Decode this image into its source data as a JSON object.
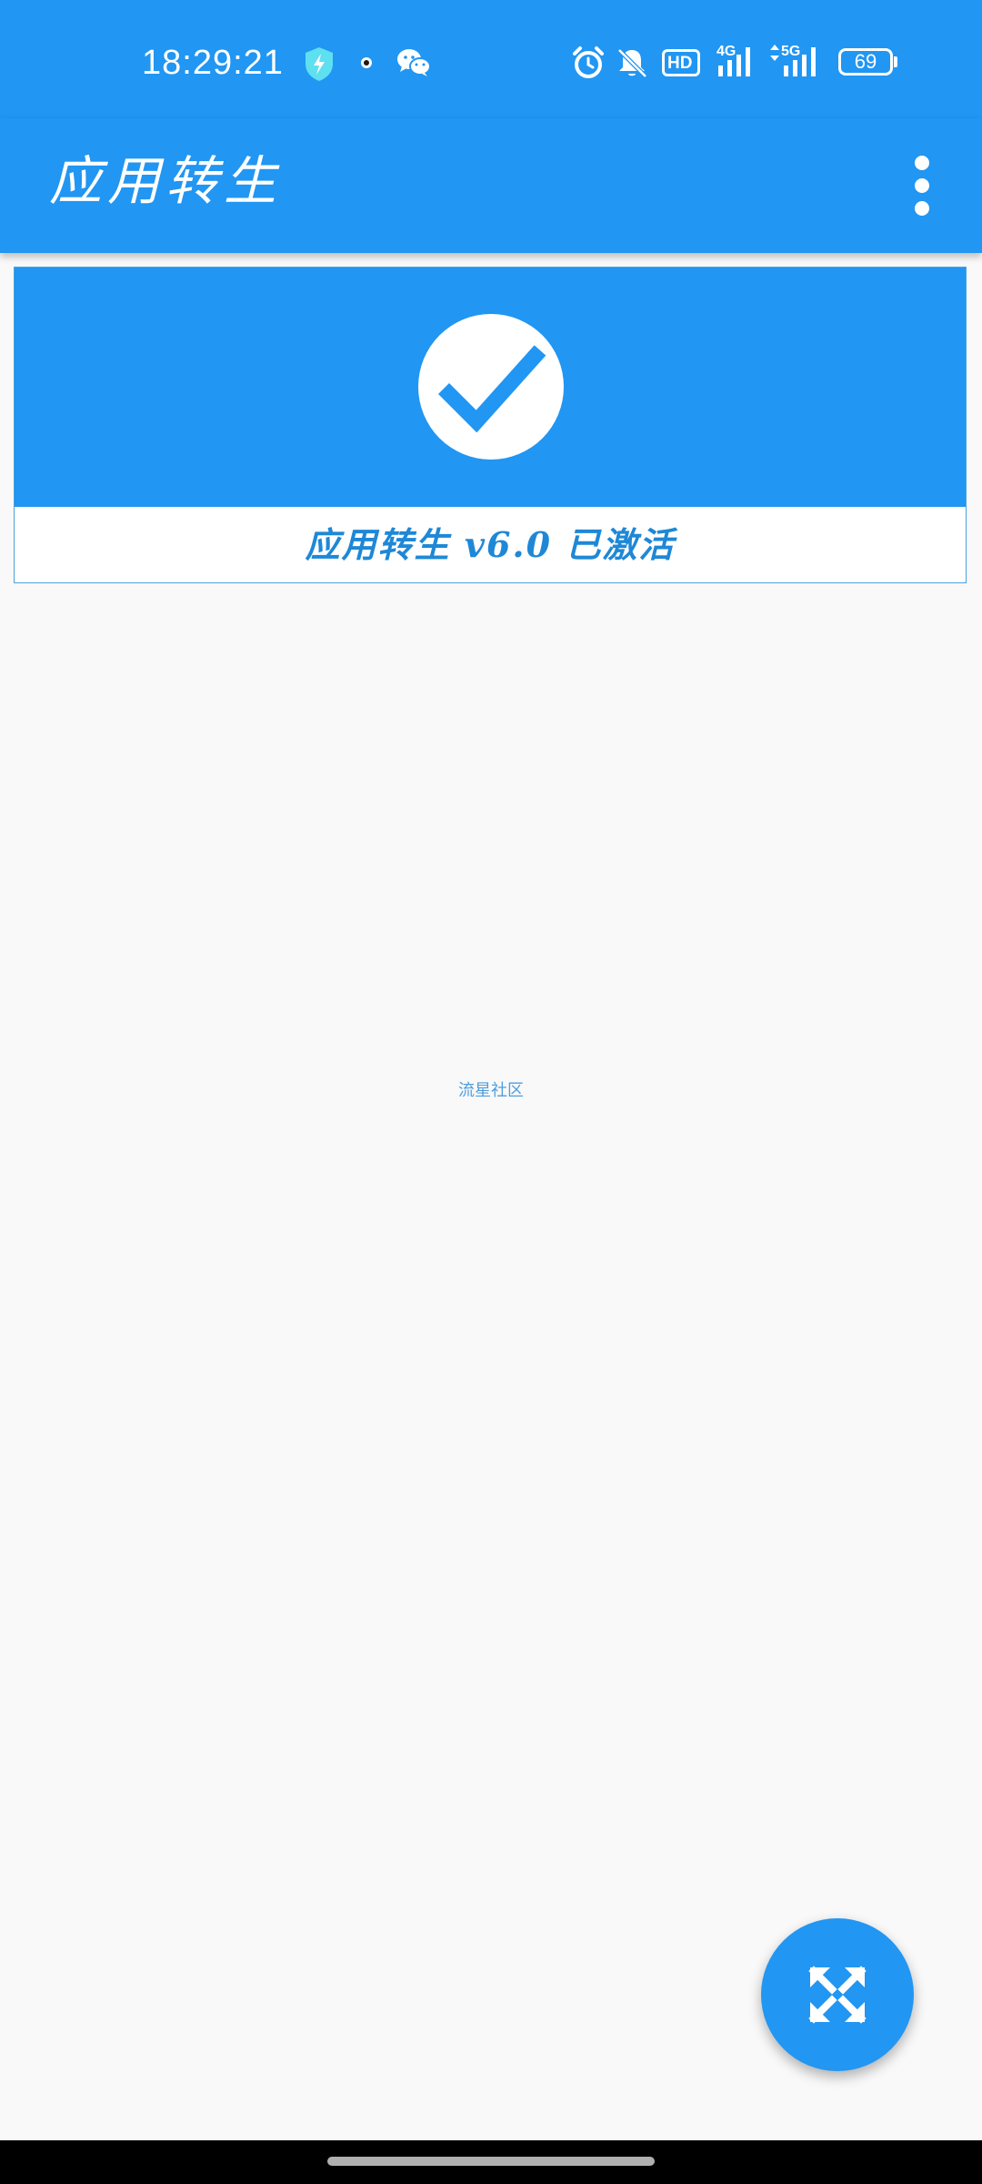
{
  "status_bar": {
    "time": "18:29:21",
    "icons": [
      "shield-bolt-icon",
      "dot-icon",
      "wechat-icon",
      "alarm-icon",
      "bell-muted-icon",
      "hd-icon",
      "signal-4g-icon",
      "signal-5g-icon",
      "battery-icon"
    ],
    "hd_label": "HD",
    "net_4g_label": "4G",
    "net_5g_label": "5G",
    "battery_level": "69"
  },
  "app_bar": {
    "title": "应用转生",
    "overflow_icon": "more-vertical-icon"
  },
  "status_card": {
    "icon": "check-circle-icon",
    "label": "应用转生 v6.0 已激活"
  },
  "footer": {
    "community_text": "流星社区"
  },
  "fab": {
    "icon": "expand-arrows-icon"
  },
  "colors": {
    "primary": "#2196f3",
    "background": "#f9f9f9",
    "label_text": "#1e88d6"
  }
}
